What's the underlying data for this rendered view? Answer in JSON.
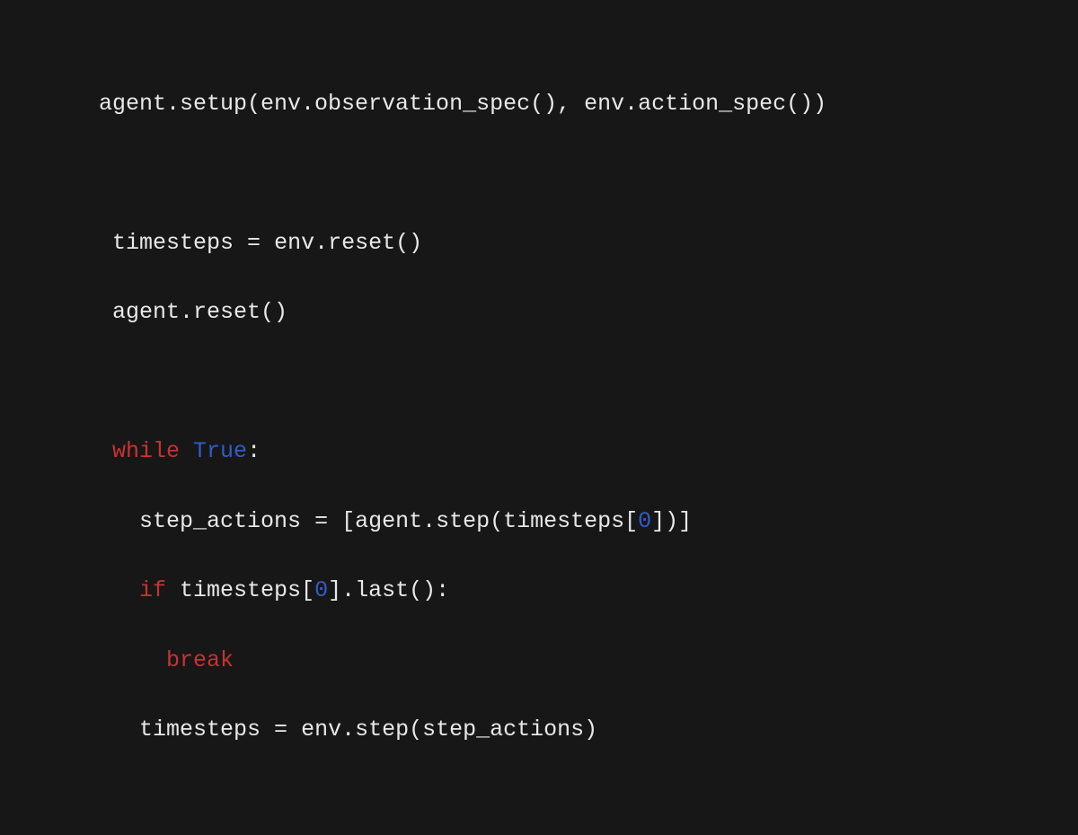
{
  "code": {
    "line1": {
      "t1": "agent.setup(env.observation_spec(), env.action_spec())"
    },
    "line2": "",
    "line3": {
      "indent": " ",
      "t1": "timesteps ",
      "eq": "=",
      "t2": " env.reset()"
    },
    "line4": {
      "indent": " ",
      "t1": "agent.reset()"
    },
    "line5": "",
    "line6": {
      "indent": " ",
      "kw": "while",
      "sp": " ",
      "const": "True",
      "colon": ":"
    },
    "line7": {
      "indent": "   ",
      "t1": "step_actions ",
      "eq": "=",
      "t2": " [agent.step(timesteps[",
      "n0": "0",
      "t3": "])]"
    },
    "line8": {
      "indent": "   ",
      "kw": "if",
      "t1": " timesteps[",
      "n0": "0",
      "t2": "].last():"
    },
    "line9": {
      "indent": "     ",
      "kw": "break"
    },
    "line10": {
      "indent": "   ",
      "t1": "timesteps ",
      "eq": "=",
      "t2": " env.step(step_actions)"
    }
  }
}
